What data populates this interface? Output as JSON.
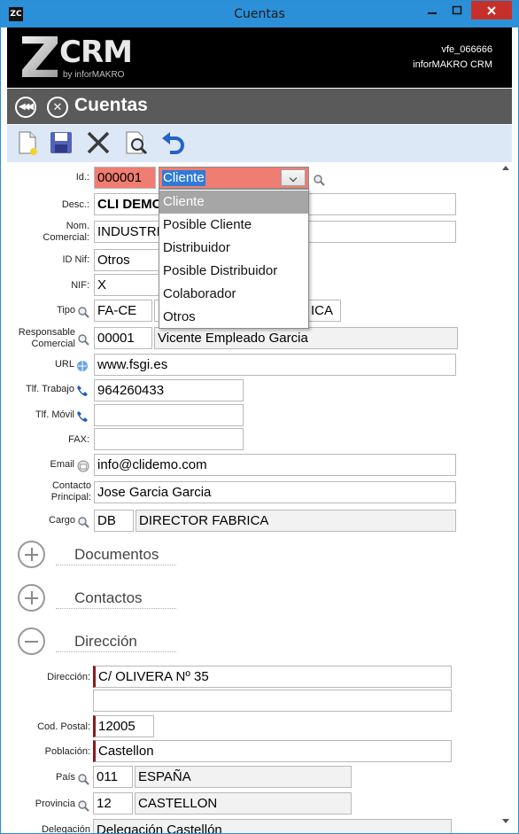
{
  "window": {
    "title": "Cuentas",
    "app_icon": "ZC",
    "minimize_icon": "minimize-icon",
    "maximize_icon": "maximize-icon",
    "close_icon": "close-icon"
  },
  "header": {
    "logo_main": "CRM",
    "logo_sub": "by inforMAKRO",
    "user_id": "vfe_066666",
    "app_name": "inforMAKRO CRM"
  },
  "nav": {
    "title": "Cuentas"
  },
  "form": {
    "id_label": "Id.:",
    "id_value": "000001",
    "tipo_cuenta_value": "Cliente",
    "desc_label": "Desc.:",
    "desc_value": "CLI DEMO",
    "nom_comercial_label": "Nom. Comercial:",
    "nom_comercial_value": "INDUSTRIAS",
    "id_nif_label": "ID Nif:",
    "id_nif_value": "Otros",
    "nif_label": "NIF:",
    "nif_value": "X",
    "tipo_label": "Tipo",
    "tipo_code": "FA-CE",
    "tipo_desc": "ICA",
    "responsable_label": "Responsable Comercial",
    "responsable_code": "00001",
    "responsable_name": "Vicente Empleado Garcia",
    "url_label": "URL",
    "url_value": "www.fsgi.es",
    "tlf_trabajo_label": "Tlf. Trabajo",
    "tlf_trabajo_value": "964260433",
    "tlf_movil_label": "Tlf. Móvil",
    "tlf_movil_value": "",
    "fax_label": "FAX:",
    "fax_value": "",
    "email_label": "Email",
    "email_value": "info@clidemo.com",
    "contacto_label": "Contacto Principal:",
    "contacto_value": "Jose Garcia Garcia",
    "cargo_label": "Cargo",
    "cargo_code": "DB",
    "cargo_desc": "DIRECTOR FABRICA"
  },
  "dropdown": {
    "options": [
      "Cliente",
      "Posible Cliente",
      "Distribuidor",
      "Posible Distribuidor",
      "Colaborador",
      "Otros"
    ],
    "selected": "Cliente"
  },
  "sections": {
    "documentos": "Documentos",
    "contactos": "Contactos",
    "direccion": "Dirección"
  },
  "address": {
    "direccion_label": "Dirección:",
    "direccion_value": "C/ OLIVERA Nº 35",
    "direccion2_value": "",
    "cp_label": "Cod. Postal:",
    "cp_value": "12005",
    "poblacion_label": "Población:",
    "poblacion_value": "Castellon",
    "pais_label": "País",
    "pais_code": "011",
    "pais_name": "ESPAÑA",
    "provincia_label": "Provincia",
    "provincia_code": "12",
    "provincia_name": "CASTELLON",
    "delegacion_label": "Delegación",
    "delegacion_value": "Delegación Castellón"
  },
  "colors": {
    "titlebar": "#2b90d8",
    "navbar": "#5a5a5a",
    "toolbar": "#dce8f6",
    "required_field": "#f07d72",
    "selection": "#2f7bd8"
  }
}
